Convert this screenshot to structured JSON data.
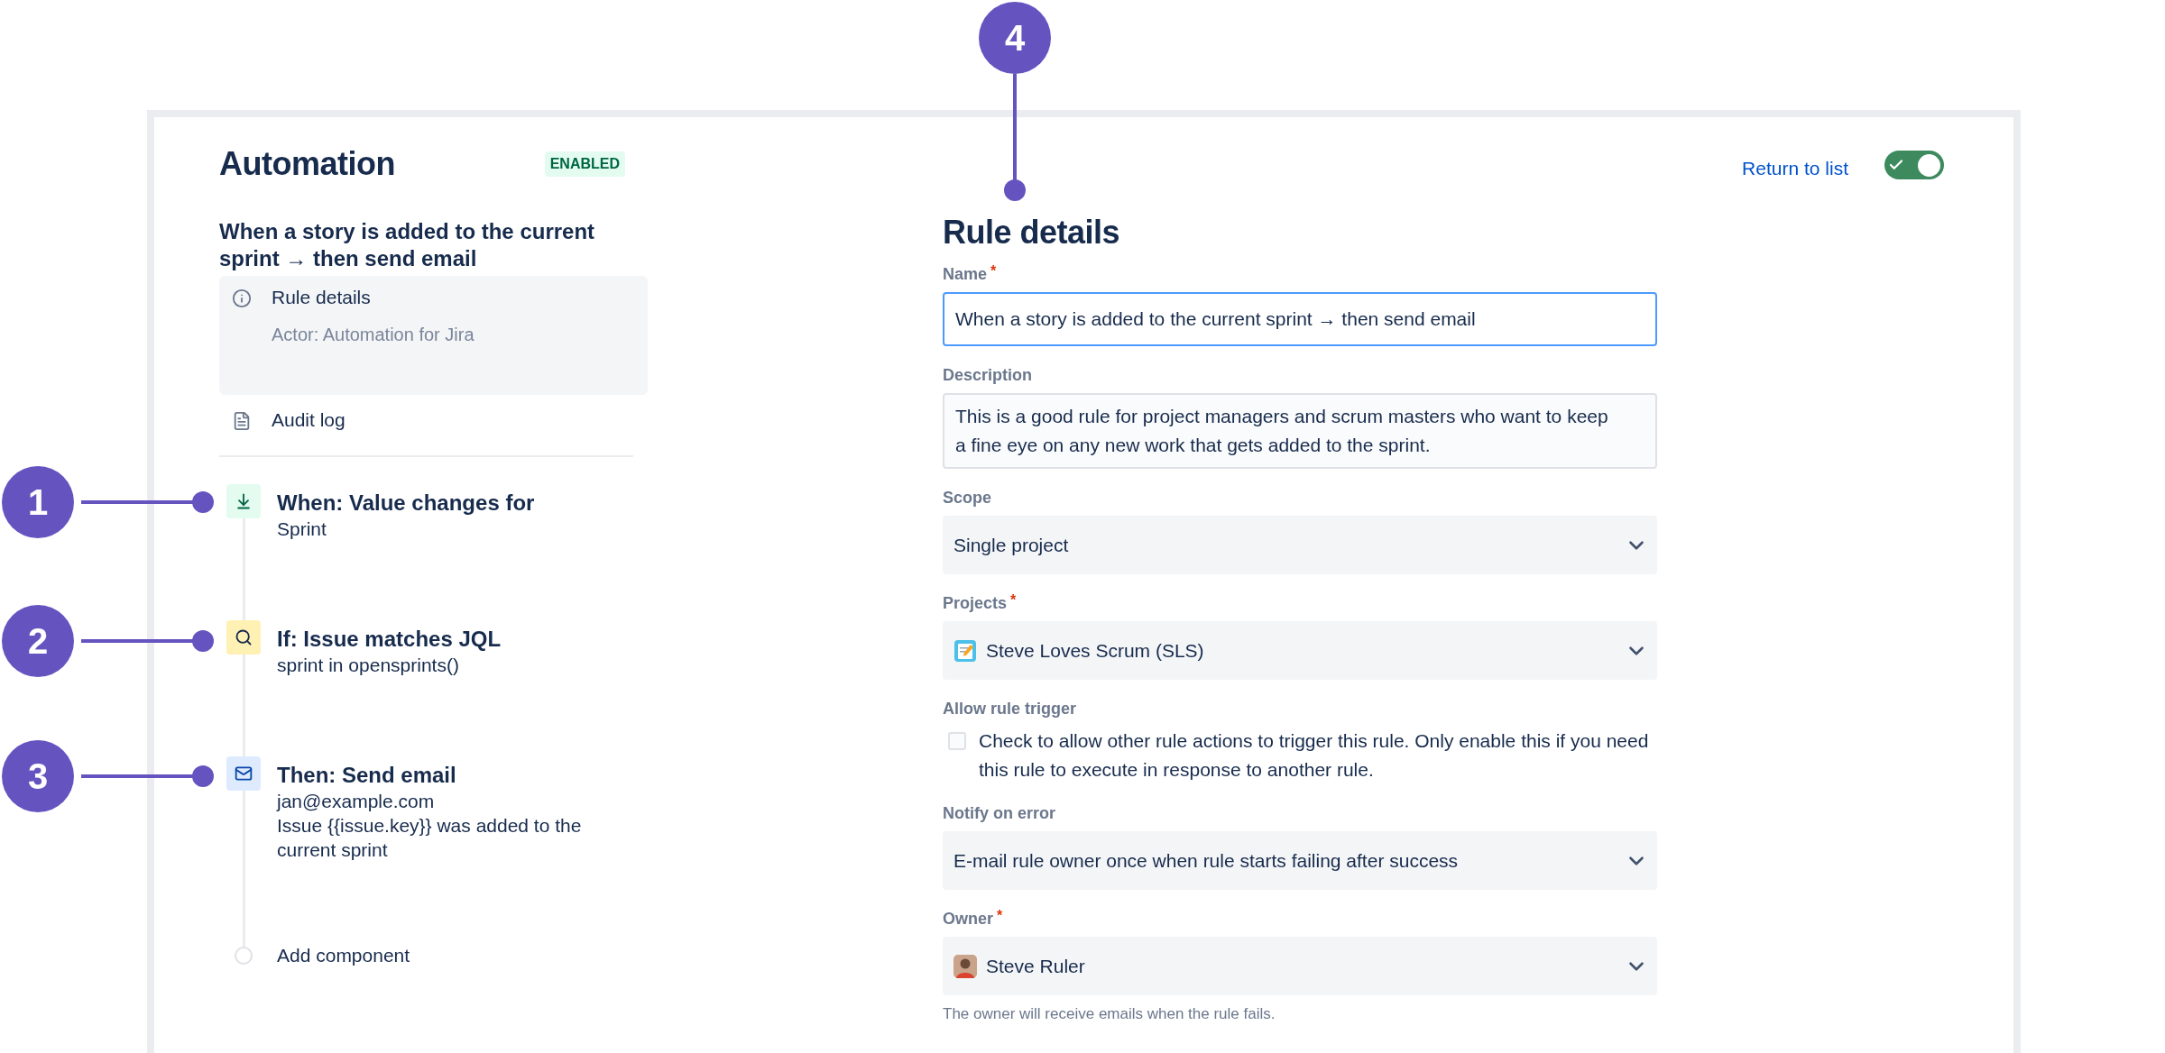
{
  "callouts": [
    {
      "label": "4"
    },
    {
      "label": "1"
    },
    {
      "label": "2"
    },
    {
      "label": "3"
    }
  ],
  "header": {
    "title": "Automation",
    "status": "ENABLED"
  },
  "rule_title": "When a story is added to the current sprint → then send email",
  "nav": [
    {
      "kind": "info",
      "label": "Rule details",
      "sublabel": "Actor: Automation for Jira",
      "selected": true
    },
    {
      "kind": "log",
      "label": "Audit log",
      "selected": false
    }
  ],
  "components": [
    {
      "kind": "trigger",
      "title": "When: Value changes for",
      "lines": [
        "Sprint"
      ]
    },
    {
      "kind": "condition",
      "title": "If: Issue matches JQL",
      "lines": [
        "sprint in opensprints()"
      ]
    },
    {
      "kind": "action",
      "title": "Then: Send email",
      "lines": [
        "jan@example.com",
        "Issue {{issue.key}} was added to the current sprint"
      ]
    },
    {
      "kind": "add",
      "title": "Add component"
    }
  ],
  "top_actions": {
    "link": "Return to list",
    "enabled_toggle": true
  },
  "form": {
    "heading": "Rule details",
    "fields": [
      {
        "kind": "text",
        "label": "Name",
        "required_mark": "*",
        "value": "When a story is added to the current sprint → then send email",
        "focused": true
      },
      {
        "kind": "textarea",
        "label": "Description",
        "value": "This is a good rule for project managers and scrum masters who want to keep a fine eye on any new work that gets added to the sprint."
      },
      {
        "kind": "select",
        "label": "Scope",
        "value": "Single project"
      },
      {
        "kind": "project_select",
        "label": "Projects",
        "required_mark": "*",
        "value": "Steve Loves Scrum (SLS)"
      },
      {
        "kind": "checkbox",
        "label": "Allow rule trigger",
        "text": "Check to allow other rule actions to trigger this rule. Only enable this if you need this rule to execute in response to another rule.",
        "checked": false
      },
      {
        "kind": "select",
        "label": "Notify on error",
        "value": "E-mail rule owner once when rule starts failing after success"
      },
      {
        "kind": "user_select",
        "label": "Owner",
        "required_mark": "*",
        "value": "Steve Ruler",
        "helper": "The owner will receive emails when the rule fails."
      }
    ]
  }
}
